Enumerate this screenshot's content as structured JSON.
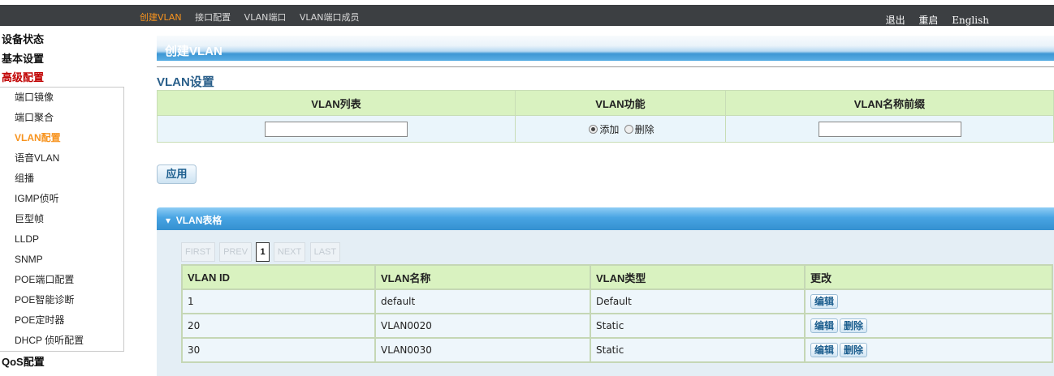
{
  "topnav": {
    "items": [
      "创建VLAN",
      "接口配置",
      "VLAN端口",
      "VLAN端口成员"
    ],
    "right": [
      "退出",
      "重启",
      "English"
    ]
  },
  "sidebar": {
    "top1": "设备状态",
    "top2": "基本设置",
    "top3": "高级配置",
    "sub": [
      "端口镜像",
      "端口聚合",
      "VLAN配置",
      "语音VLAN",
      "组播",
      "IGMP侦听",
      "巨型帧",
      "LLDP",
      "SNMP",
      "POE端口配置",
      "POE智能诊断",
      "POE定时器",
      "DHCP 侦听配置"
    ],
    "top4": "QoS配置"
  },
  "main": {
    "title": "创建VLAN",
    "section": "VLAN设置",
    "form": {
      "col1": "VLAN列表",
      "col2": "VLAN功能",
      "col3": "VLAN名称前缀",
      "vlan_list_value": "",
      "name_prefix_value": "",
      "radio_add": "添加",
      "radio_delete": "删除"
    },
    "apply": "应用",
    "table_panel": "VLAN表格",
    "pager": [
      "FIRST",
      "PREV",
      "1",
      "NEXT",
      "LAST"
    ],
    "columns": [
      "VLAN ID",
      "VLAN名称",
      "VLAN类型",
      "更改"
    ],
    "rows": [
      {
        "id": "1",
        "name": "default",
        "type": "Default",
        "edit": "编辑",
        "del": ""
      },
      {
        "id": "20",
        "name": "VLAN0020",
        "type": "Static",
        "edit": "编辑",
        "del": "删除"
      },
      {
        "id": "30",
        "name": "VLAN0030",
        "type": "Static",
        "edit": "编辑",
        "del": "删除"
      }
    ]
  }
}
